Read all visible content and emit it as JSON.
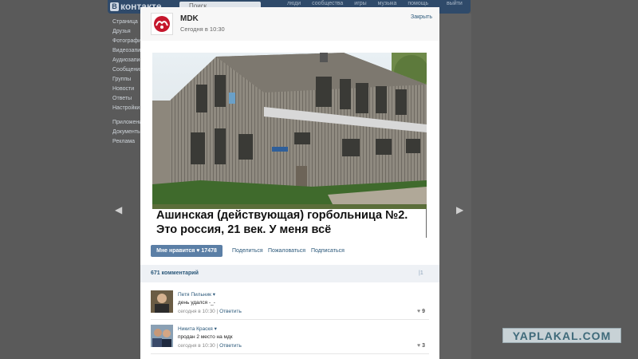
{
  "background": {
    "logo_text": "контакте",
    "logo_letter": "В",
    "search_placeholder": "Поиск",
    "nav_items": [
      "люди",
      "сообщества",
      "игры",
      "музыка",
      "помощь"
    ],
    "nav_exit": "выйти",
    "sidebar_items": [
      "Страница",
      "Друзья",
      "Фотографии",
      "Видеозаписи",
      "Аудиозаписи",
      "Сообщения",
      "Группы",
      "Новости",
      "Ответы",
      "Настройки"
    ],
    "sidebar_items_2": [
      "Приложения",
      "Документы",
      "Реклама"
    ]
  },
  "post": {
    "author": "MDK",
    "time": "Сегодня в 10:30",
    "close_label": "Закрыть",
    "caption_line1": "Ашинская (действующая) горбольница №2.",
    "caption_line2": "Это россия, 21 век. У меня всё",
    "like_label": "Мне нравится",
    "like_count": "17478",
    "share_label": "Поделиться",
    "complain_label": "Пожаловаться",
    "subscribe_label": "Подписаться"
  },
  "comments_section": {
    "count_label": "671 комментарий",
    "right_count": "1"
  },
  "comments": [
    {
      "author": "Петя Пильник",
      "text": "день удался -_-",
      "time": "сегодня в 10:30",
      "reply": "Ответить",
      "likes": "9"
    },
    {
      "author": "Никита Краскя",
      "text": "продан 2 место на мдк",
      "time": "сегодня в 10:30",
      "reply": "Ответить",
      "likes": "3"
    }
  ],
  "watermark": "YAPLAKAL.COM",
  "colors": {
    "accent": "#2b587a",
    "like_button": "#5b7fa6",
    "header": "#2f4a6a"
  }
}
